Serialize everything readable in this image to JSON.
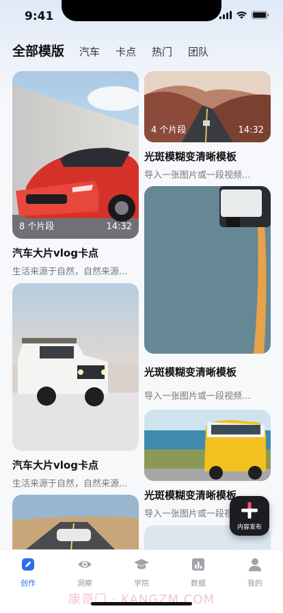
{
  "status": {
    "time": "9:41"
  },
  "tabs": [
    "全部模版",
    "汽车",
    "卡点",
    "热门",
    "团队"
  ],
  "cards": [
    {
      "clips": "8 个片段",
      "duration": "14:32",
      "title": "汽车大片vlog卡点",
      "desc": "生活来源于自然，自然来源..."
    },
    {
      "clips": "4 个片段",
      "duration": "14:32",
      "title": "光斑模糊变清晰模板",
      "desc": "导入一张图片或一段视频..."
    },
    {
      "title": "光斑模糊变清晰模板",
      "desc": "导入一张图片或一段视频..."
    },
    {
      "title": "汽车大片vlog卡点",
      "desc": "生活来源于自然，自然来源..."
    },
    {
      "title": "光斑模糊变清晰模板",
      "desc": "导入一张图片或一段视频..."
    }
  ],
  "fab": {
    "label": "内容发布"
  },
  "nav": [
    {
      "label": "创作",
      "icon": "pen-icon",
      "active": true
    },
    {
      "label": "洞察",
      "icon": "eye-icon"
    },
    {
      "label": "学院",
      "icon": "graduation-cap-icon"
    },
    {
      "label": "数据",
      "icon": "bar-chart-icon"
    },
    {
      "label": "我的",
      "icon": "user-icon"
    }
  ],
  "watermark": "康哥门 · KANGZM.COM",
  "colors": {
    "accent": "#2b6cf0",
    "fab_bg": "#1c1d22",
    "muted": "#999999"
  }
}
